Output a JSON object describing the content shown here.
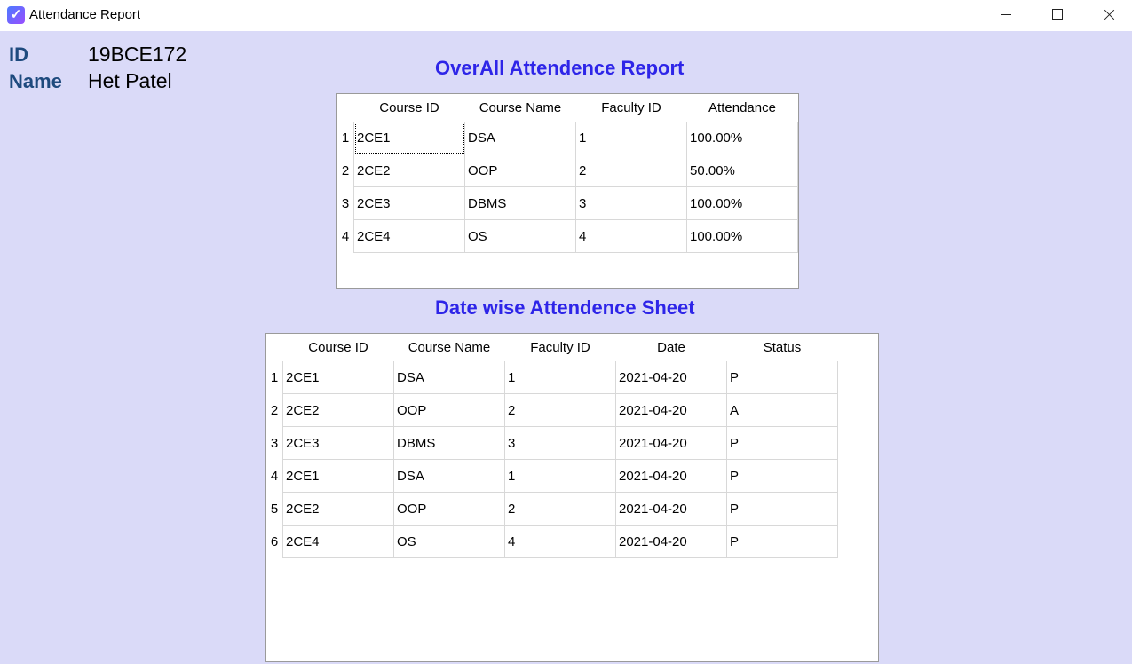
{
  "window": {
    "title": "Attendance Report"
  },
  "student": {
    "id_label": "ID",
    "id_value": "19BCE172",
    "name_label": "Name",
    "name_value": "Het Patel"
  },
  "overall": {
    "heading": "OverAll Attendence Report",
    "columns": [
      "Course ID",
      "Course Name",
      "Faculty ID",
      "Attendance"
    ],
    "rows": [
      {
        "n": "1",
        "cells": [
          "2CE1",
          "DSA",
          "1",
          "100.00%"
        ]
      },
      {
        "n": "2",
        "cells": [
          "2CE2",
          "OOP",
          "2",
          "50.00%"
        ]
      },
      {
        "n": "3",
        "cells": [
          "2CE3",
          "DBMS",
          "3",
          "100.00%"
        ]
      },
      {
        "n": "4",
        "cells": [
          "2CE4",
          "OS",
          "4",
          "100.00%"
        ]
      }
    ]
  },
  "datewise": {
    "heading": "Date wise Attendence Sheet",
    "columns": [
      "Course ID",
      "Course Name",
      "Faculty ID",
      "Date",
      "Status"
    ],
    "rows": [
      {
        "n": "1",
        "cells": [
          "2CE1",
          "DSA",
          "1",
          "2021-04-20",
          "P"
        ]
      },
      {
        "n": "2",
        "cells": [
          "2CE2",
          "OOP",
          "2",
          "2021-04-20",
          "A"
        ]
      },
      {
        "n": "3",
        "cells": [
          "2CE3",
          "DBMS",
          "3",
          "2021-04-20",
          "P"
        ]
      },
      {
        "n": "4",
        "cells": [
          "2CE1",
          "DSA",
          "1",
          "2021-04-20",
          "P"
        ]
      },
      {
        "n": "5",
        "cells": [
          "2CE2",
          "OOP",
          "2",
          "2021-04-20",
          "P"
        ]
      },
      {
        "n": "6",
        "cells": [
          "2CE4",
          "OS",
          "4",
          "2021-04-20",
          "P"
        ]
      }
    ]
  }
}
